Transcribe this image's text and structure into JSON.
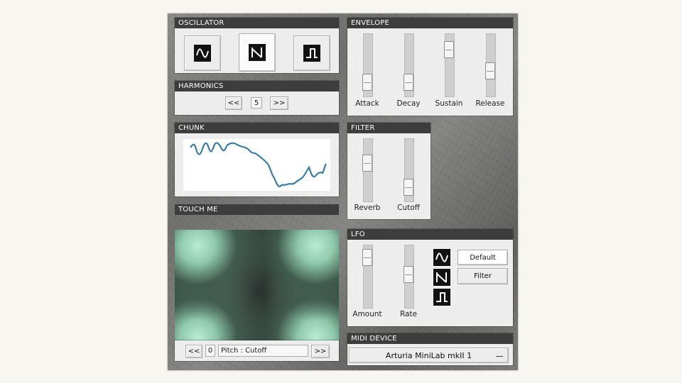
{
  "panels": {
    "oscillator": "OSCILLATOR",
    "harmonics": "HARMONICS",
    "chunk": "CHUNK",
    "touch": "TOUCH ME",
    "envelope": "ENVELOPE",
    "filter": "FILTER",
    "lfo": "LFO",
    "midi": "MIDI DEVICE"
  },
  "oscillator": {
    "waves": [
      "sine-wave-icon",
      "sawtooth-wave-icon",
      "square-wave-icon"
    ],
    "selected": 1
  },
  "harmonics": {
    "prev": "<<",
    "value": "5",
    "next": ">>"
  },
  "envelope": {
    "sliders": [
      {
        "label": "Attack",
        "value": 0.12
      },
      {
        "label": "Decay",
        "value": 0.12
      },
      {
        "label": "Sustain",
        "value": 0.85
      },
      {
        "label": "Release",
        "value": 0.38
      }
    ]
  },
  "filter": {
    "sliders": [
      {
        "label": "Reverb",
        "value": 0.65
      },
      {
        "label": "Cutoff",
        "value": 0.12
      }
    ]
  },
  "lfo": {
    "sliders": [
      {
        "label": "Amount",
        "value": 0.92
      },
      {
        "label": "Rate",
        "value": 0.55
      }
    ],
    "waves": [
      "sine-wave-icon",
      "sawtooth-wave-icon",
      "square-wave-icon"
    ],
    "targets": [
      "Default",
      "Filter"
    ]
  },
  "touch": {
    "prev": "<<",
    "value": "0",
    "mapping": "Pitch :  Cutoff",
    "next": ">>"
  },
  "midi": {
    "device": "Arturia MiniLab mkII 1"
  },
  "colors": {
    "title_bar": "#3d3d3d",
    "panel": "#ededed",
    "waveform": "#3a7ba8"
  }
}
